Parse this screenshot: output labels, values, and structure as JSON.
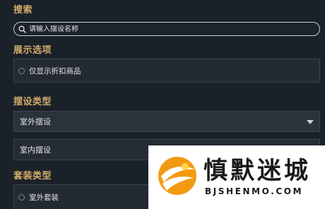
{
  "search": {
    "heading": "搜索",
    "placeholder": "请输入摆设名称"
  },
  "display_options": {
    "heading": "展示选项",
    "discount_only_label": "仅显示折扣商品"
  },
  "furnishing_type": {
    "heading": "摆设类型",
    "selected": "室外摆设",
    "option_indoor": "室内摆设"
  },
  "set_type": {
    "heading": "套装类型",
    "outdoor_set_label": "室外套装"
  },
  "watermark": {
    "brand_cn": "慎默迷城",
    "brand_en": "BJSHENMO.COM"
  },
  "colors": {
    "accent_heading": "#d2ac6a",
    "background": "#1b2129"
  }
}
